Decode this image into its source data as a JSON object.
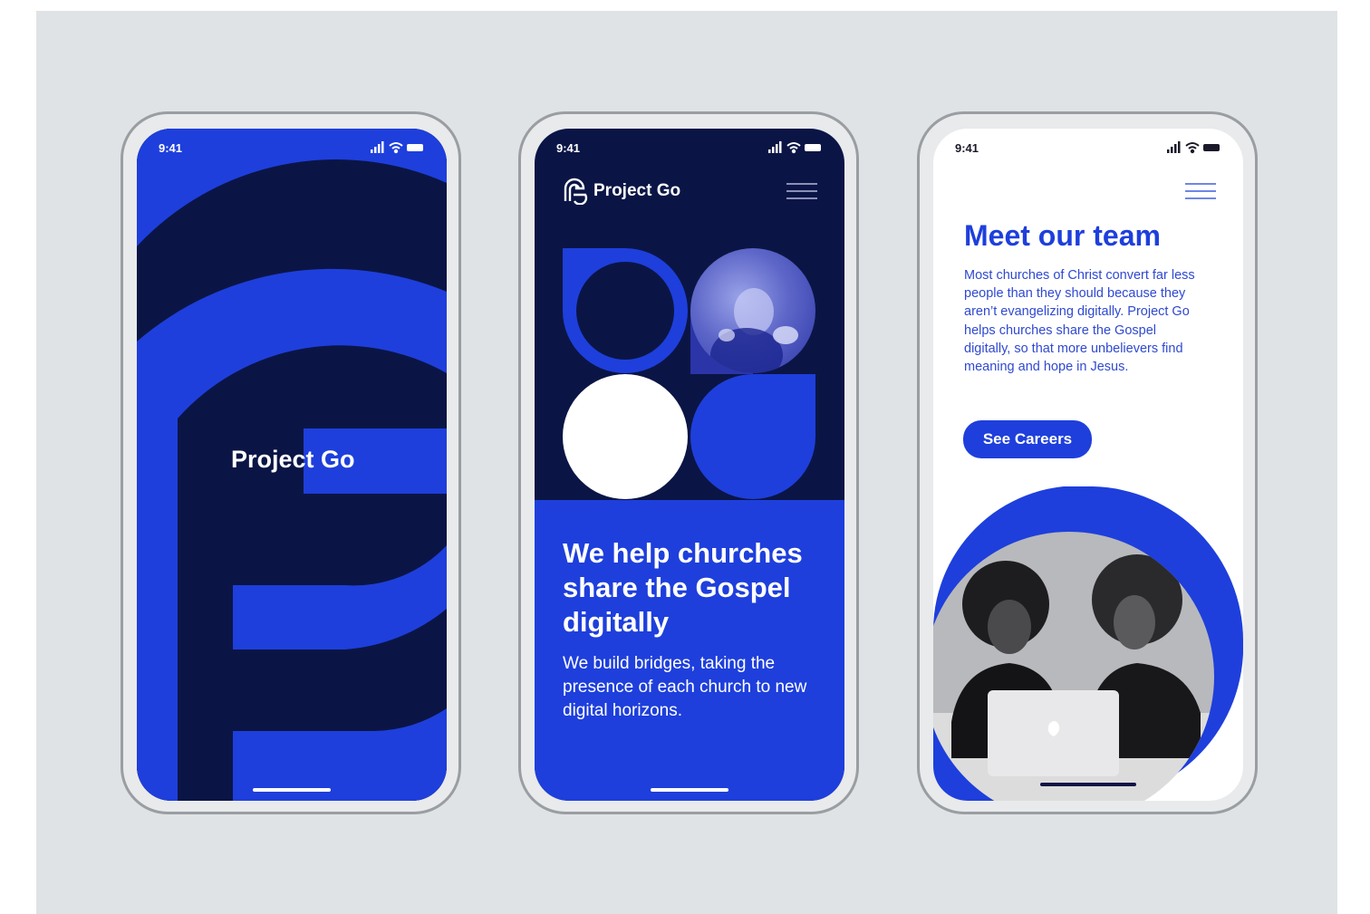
{
  "colors": {
    "navy": "#0b1545",
    "brand_blue": "#1e3fdc",
    "backdrop": "#e0e3e5",
    "white": "#ffffff"
  },
  "phones": [
    {
      "status_time": "9:41",
      "splash_title": "Project Go"
    },
    {
      "status_time": "9:41",
      "brand": "Project Go",
      "hero_title": "We help churches share the Gospel digitally",
      "hero_subtitle": "We build bridges, taking the presence of each church to new digital horizons."
    },
    {
      "status_time": "9:41",
      "team_title": "Meet our team",
      "team_body": "Most churches of Christ convert far less people than they should because they aren’t evangelizing digitally. Project Go helps churches share the Gospel digitally, so that more unbelievers find meaning and hope in Jesus.",
      "careers_button": "See Careers"
    }
  ],
  "icons": {
    "signal": "signal-icon",
    "wifi": "wifi-icon",
    "battery": "battery-icon",
    "menu": "hamburger-menu-icon",
    "logo": "project-go-logo-icon"
  }
}
